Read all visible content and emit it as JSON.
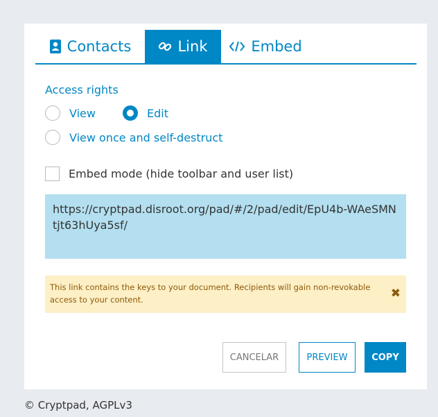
{
  "tabs": {
    "contacts": {
      "label": "Contacts",
      "icon": "address-book-icon"
    },
    "link": {
      "label": "Link",
      "icon": "link-icon",
      "active": true
    },
    "embed": {
      "label": "Embed",
      "icon": "code-icon"
    }
  },
  "access": {
    "title": "Access rights",
    "options": [
      {
        "label": "View",
        "checked": false
      },
      {
        "label": "Edit",
        "checked": true
      },
      {
        "label": "View once and self-destruct",
        "checked": false
      }
    ]
  },
  "embed_mode": {
    "label": "Embed mode (hide toolbar and user list)",
    "checked": false
  },
  "link_url": "https://cryptpad.disroot.org/pad/#/2/pad/edit/EpU4b-WAeSMNtjt63hUya5sf/",
  "warning": {
    "text": "This link contains the keys to your document. Recipients will gain non-revokable access to your content.",
    "close_icon": "close-icon"
  },
  "buttons": {
    "cancel": "CANCELAR",
    "preview": "PREVIEW",
    "copy": "COPY"
  },
  "footer": "© Cryptpad, AGPLv3",
  "colors": {
    "accent": "#0087c5",
    "link_bg": "#b3dff0",
    "warning_bg": "#fdefc6",
    "warning_text": "#8c5a0a"
  }
}
